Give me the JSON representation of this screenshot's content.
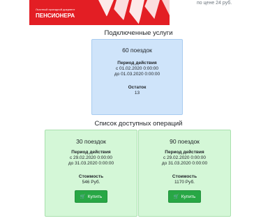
{
  "banner": {
    "small_text": "Льготный проездной документ",
    "big_text": "ПЕНСИОНЕРА",
    "bg_color": "#e31e24"
  },
  "price_note": "по цене 24 руб.",
  "connected": {
    "heading": "Подключенные услуги",
    "card": {
      "title": "60 поездок",
      "period_label": "Период действия",
      "from": "с 01.02.2020 0:00:00",
      "to": "до 01.03.2020 0:00:00",
      "remaining_label": "Остаток",
      "remaining_value": "13"
    }
  },
  "operations": {
    "heading": "Список доступных операций",
    "cards": [
      {
        "title": "30 поездок",
        "period_label": "Период действия",
        "from": "с 29.02.2020 0:00:00",
        "to": "до 31.03.2020 0:00:00",
        "cost_label": "Стоимость",
        "cost_value": "546 Руб.",
        "button_label": "Купить"
      },
      {
        "title": "90 поездок",
        "period_label": "Период действия",
        "from": "с 29.02.2020 0:00:00",
        "to": "до 31.03.2020 0:00:00",
        "cost_label": "Стоимость",
        "cost_value": "1170 Руб.",
        "button_label": "Купить"
      }
    ]
  },
  "colors": {
    "info_card": "#cfe4fa",
    "op_card": "#d4f7d7",
    "buy_button": "#28a745"
  },
  "icons": {
    "buy": "cart-icon"
  }
}
